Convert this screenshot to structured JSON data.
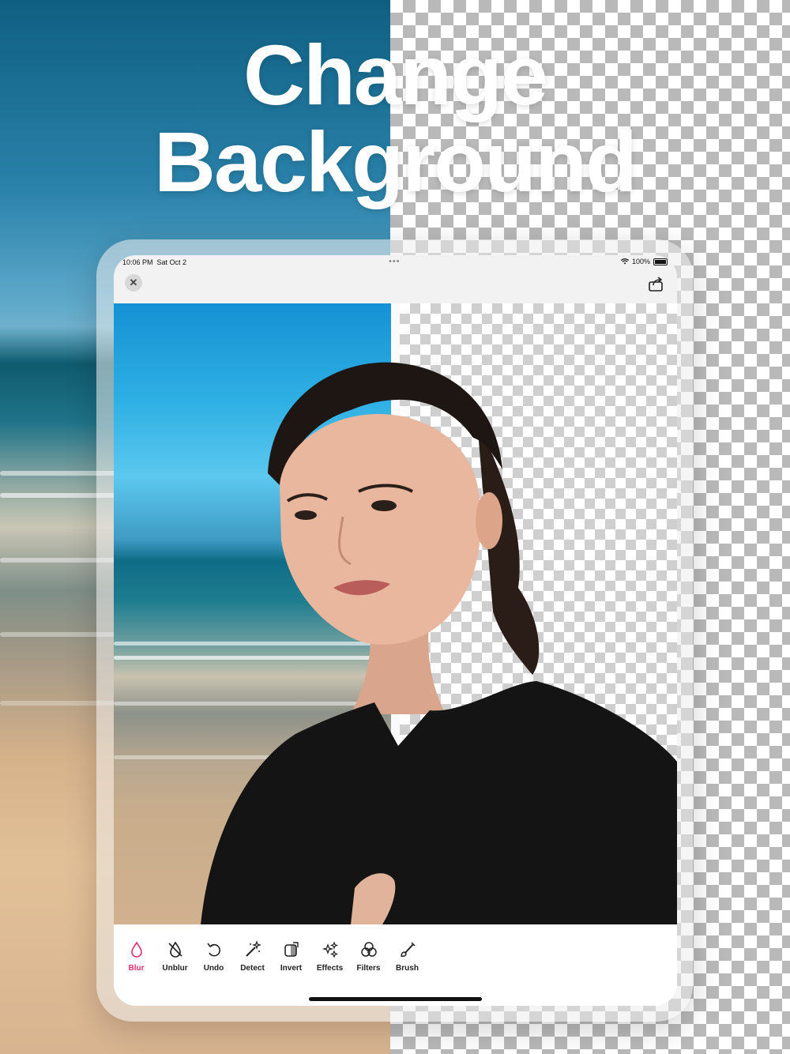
{
  "headline": {
    "line1": "Change",
    "line2": "Background"
  },
  "status_bar": {
    "time": "10:06 PM",
    "date": "Sat Oct 2",
    "battery": "100%"
  },
  "navbar": {
    "close_label": "✕"
  },
  "toolbar": {
    "active_tool": "Blur",
    "accent_color": "#e0336c",
    "tools": [
      {
        "label": "Blur",
        "icon": "drop-icon"
      },
      {
        "label": "Unblur",
        "icon": "drop-slash-icon"
      },
      {
        "label": "Undo",
        "icon": "undo-icon"
      },
      {
        "label": "Detect",
        "icon": "magic-wand-icon"
      },
      {
        "label": "Invert",
        "icon": "invert-icon"
      },
      {
        "label": "Effects",
        "icon": "sparkles-icon"
      },
      {
        "label": "Filters",
        "icon": "filters-circles-icon"
      },
      {
        "label": "Brush",
        "icon": "brush-icon"
      }
    ]
  }
}
